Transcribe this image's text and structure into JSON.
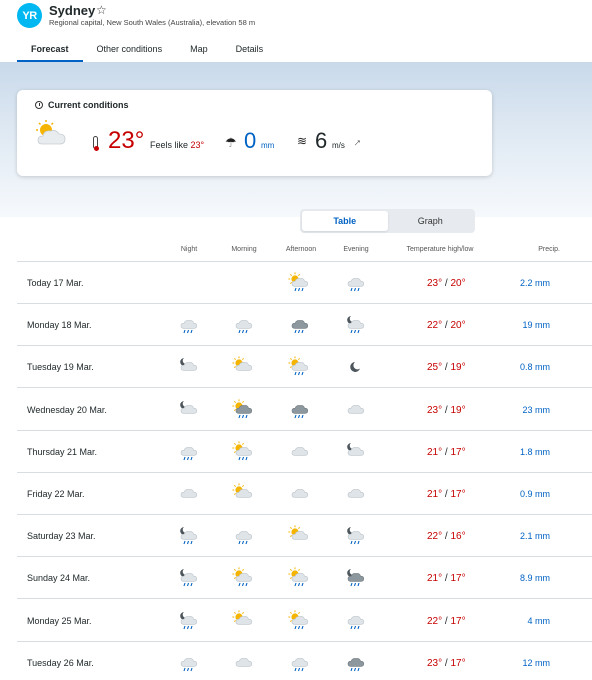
{
  "header": {
    "logo_text": "YR",
    "city": "Sydney",
    "star": "☆",
    "subtitle": "Regional capital, New South Wales (Australia), elevation 58 m",
    "tabs": [
      "Forecast",
      "Other conditions",
      "Map",
      "Details"
    ],
    "active_tab": "Forecast"
  },
  "current": {
    "title": "Current conditions",
    "icon": "partly-cloudy-day-icon",
    "temperature": "23°",
    "feels_like_label": "Feels like",
    "feels_like_value": "23°",
    "precip_value": "0",
    "precip_unit": "mm",
    "wind_value": "6",
    "wind_unit": "m/s",
    "wind_arrow": "↙"
  },
  "view_toggle": {
    "table": "Table",
    "graph": "Graph",
    "active": "Table"
  },
  "columns": {
    "night": "Night",
    "morning": "Morning",
    "afternoon": "Afternoon",
    "evening": "Evening",
    "temperature": "Temperature high/low",
    "precip": "Precip."
  },
  "colors": {
    "accent": "#0062c4",
    "temp_warm": "#c60000",
    "logo": "#00b8f1"
  },
  "days": [
    {
      "label": "Today 17 Mar.",
      "icons": [
        "",
        "",
        "cloud-sun-rain-icon",
        "cloud-rain-icon"
      ],
      "high": "23°",
      "low": "20°",
      "precip": "2.2 mm"
    },
    {
      "label": "Monday 18 Mar.",
      "icons": [
        "cloud-rain-icon",
        "cloud-rain-icon",
        "dark-cloud-rain-icon",
        "cloud-moon-rain-icon"
      ],
      "high": "22°",
      "low": "20°",
      "precip": "19 mm"
    },
    {
      "label": "Tuesday 19 Mar.",
      "icons": [
        "moon-cloud-icon",
        "sun-cloud-icon",
        "cloud-sun-rain-icon",
        "moon-icon"
      ],
      "high": "25°",
      "low": "19°",
      "precip": "0.8 mm"
    },
    {
      "label": "Wednesday 20 Mar.",
      "icons": [
        "moon-cloud-icon",
        "dark-cloud-sun-rain-icon",
        "dark-cloud-rain-icon",
        "cloud-icon"
      ],
      "high": "23°",
      "low": "19°",
      "precip": "23 mm"
    },
    {
      "label": "Thursday 21 Mar.",
      "icons": [
        "cloud-rain-icon",
        "cloud-sun-rain-icon",
        "cloud-icon",
        "moon-cloud-icon"
      ],
      "high": "21°",
      "low": "17°",
      "precip": "1.8 mm"
    },
    {
      "label": "Friday 22 Mar.",
      "icons": [
        "cloud-icon",
        "sun-cloud-icon",
        "cloud-icon",
        "cloud-icon"
      ],
      "high": "21°",
      "low": "17°",
      "precip": "0.9 mm"
    },
    {
      "label": "Saturday 23 Mar.",
      "icons": [
        "cloud-moon-rain-icon",
        "cloud-rain-icon",
        "sun-cloud-icon",
        "cloud-moon-rain-icon"
      ],
      "high": "22°",
      "low": "16°",
      "precip": "2.1 mm"
    },
    {
      "label": "Sunday 24 Mar.",
      "icons": [
        "cloud-moon-rain-icon",
        "cloud-sun-rain-icon",
        "cloud-sun-rain-icon",
        "dark-cloud-moon-rain-icon"
      ],
      "high": "21°",
      "low": "17°",
      "precip": "8.9 mm"
    },
    {
      "label": "Monday 25 Mar.",
      "icons": [
        "cloud-moon-rain-icon",
        "sun-cloud-icon",
        "cloud-sun-rain-icon",
        "cloud-rain-icon"
      ],
      "high": "22°",
      "low": "17°",
      "precip": "4 mm"
    },
    {
      "label": "Tuesday 26 Mar.",
      "icons": [
        "cloud-rain-icon",
        "cloud-icon",
        "cloud-rain-icon",
        "dark-cloud-rain-icon"
      ],
      "high": "23°",
      "low": "17°",
      "precip": "12 mm"
    }
  ]
}
